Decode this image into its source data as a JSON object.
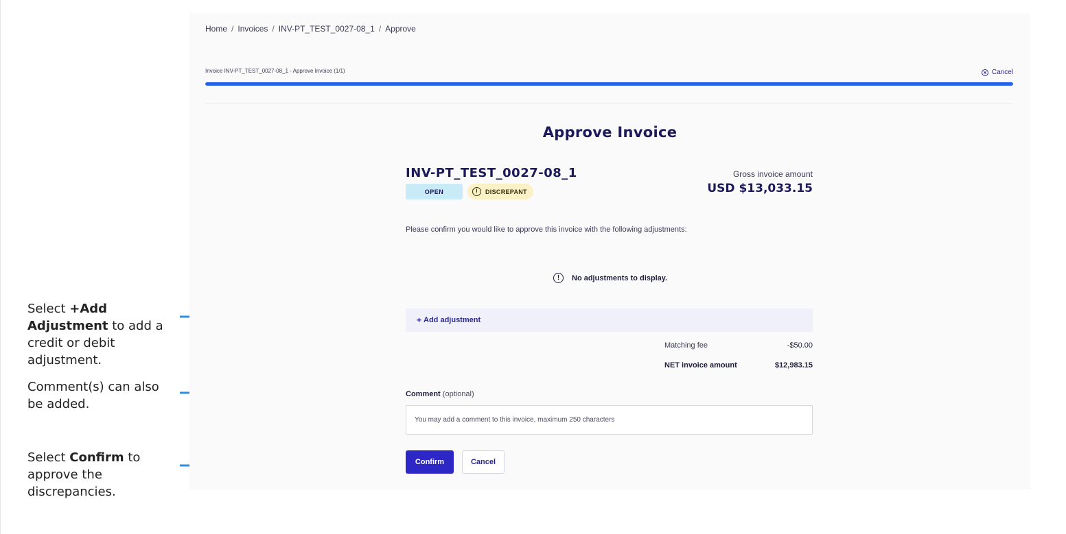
{
  "annotations": {
    "add_adjustment": {
      "prefix": "Select ",
      "bold": "+Add Adjustment",
      "suffix": " to add a credit or debit adjustment."
    },
    "comment": {
      "text": "Comment(s) can also be added."
    },
    "confirm": {
      "prefix": "Select ",
      "bold": "Confirm",
      "suffix": " to approve the discrepancies."
    },
    "arrow_color": "#2f8fe0"
  },
  "breadcrumb": [
    "Home",
    "Invoices",
    "INV-PT_TEST_0027-08_1",
    "Approve"
  ],
  "breadcrumb_separator": "/",
  "wizard": {
    "step_label": "Invoice INV-PT_TEST_0027-08_1 - Approve Invoice (1/1)",
    "cancel_label": "Cancel",
    "progress_percent": 100,
    "progress_color": "#2563eb"
  },
  "page_title": "Approve Invoice",
  "invoice": {
    "id": "INV-PT_TEST_0027-08_1",
    "status_badge": "OPEN",
    "discrepancy_badge": "DISCREPANT",
    "gross_label": "Gross invoice amount",
    "gross_amount": "USD $13,033.15"
  },
  "confirm_text": "Please confirm you would like to approve this invoice with the following adjustments:",
  "empty_adjustments": "No adjustments to display.",
  "add_adjustment_label": "Add adjustment",
  "summary": {
    "fee_label": "Matching fee",
    "fee_value": "-$50.00",
    "net_label": "NET invoice amount",
    "net_value": "$12,983.15"
  },
  "comment": {
    "label": "Comment",
    "optional": "(optional)",
    "placeholder": "You may add a comment to this invoice, maximum 250 characters"
  },
  "buttons": {
    "confirm": "Confirm",
    "cancel": "Cancel"
  },
  "colors": {
    "primary": "#2d27c6",
    "navy_text": "#1d1a5c",
    "open_badge_bg": "#c9eaf7",
    "discrepant_badge_bg": "#fbf1c7"
  }
}
